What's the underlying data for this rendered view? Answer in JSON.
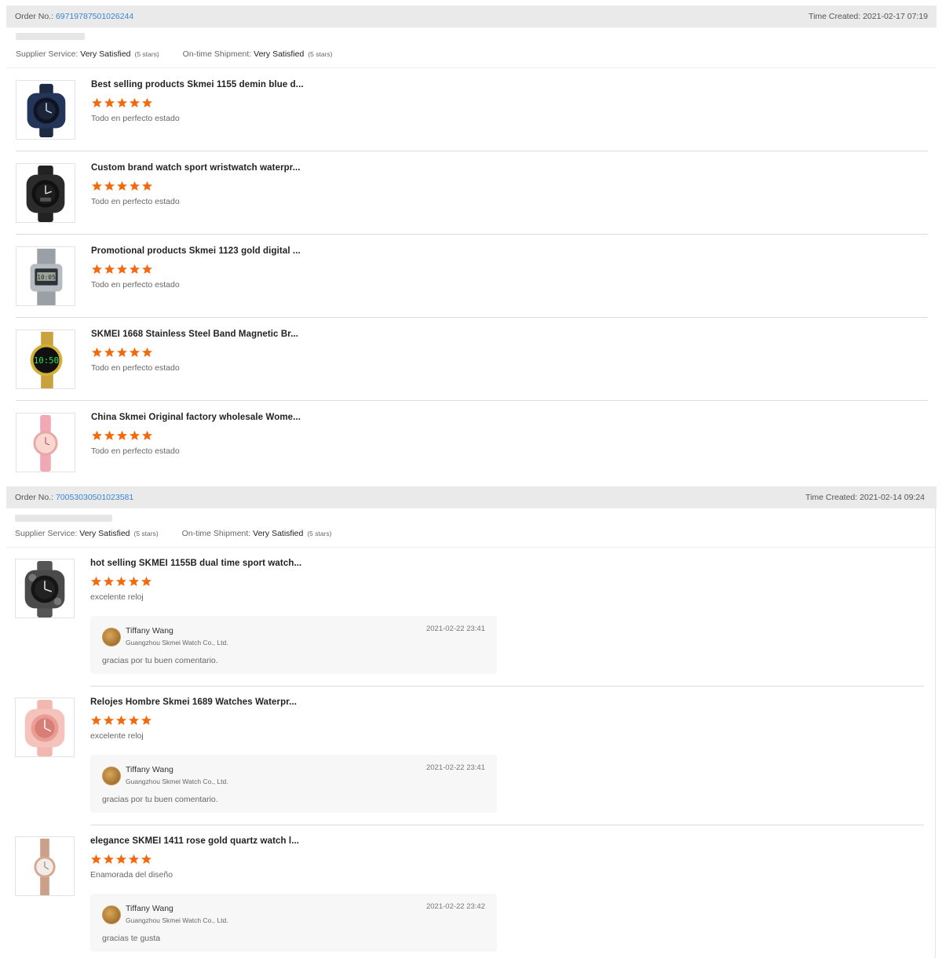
{
  "orders": [
    {
      "order_no_label": "Order No.:",
      "order_no": "69719787501026244",
      "time_created": "Time Created: 2021-02-17 07:19",
      "supplier_service_label": "Supplier Service:",
      "supplier_service_value": "Very Satisfied",
      "supplier_service_stars": "(5 stars)",
      "shipment_label": "On-time Shipment:",
      "shipment_value": "Very Satisfied",
      "shipment_stars": "(5 stars)",
      "items": [
        {
          "title": "Best selling products Skmei 1155 demin blue d...",
          "rating": 5,
          "comment": "Todo en perfecto estado",
          "thumb": "blue-sport-watch"
        },
        {
          "title": "Custom brand watch sport wristwatch waterpr...",
          "rating": 5,
          "comment": "Todo en perfecto estado",
          "thumb": "black-sport-watch"
        },
        {
          "title": "Promotional products Skmei 1123 gold digital ...",
          "rating": 5,
          "comment": "Todo en perfecto estado",
          "thumb": "silver-digital-watch"
        },
        {
          "title": "SKMEI 1668 Stainless Steel Band Magnetic Br...",
          "rating": 5,
          "comment": "Todo en perfecto estado",
          "thumb": "gold-led-watch"
        },
        {
          "title": "China Skmei Original factory wholesale Wome...",
          "rating": 5,
          "comment": "Todo en perfecto estado",
          "thumb": "pink-women-watch"
        }
      ]
    },
    {
      "order_no_label": "Order No.:",
      "order_no": "70053030501023581",
      "time_created": "Time Created: 2021-02-14 09:24",
      "supplier_service_label": "Supplier Service:",
      "supplier_service_value": "Very Satisfied",
      "supplier_service_stars": "(5 stars)",
      "shipment_label": "On-time Shipment:",
      "shipment_value": "Very Satisfied",
      "shipment_stars": "(5 stars)",
      "items": [
        {
          "title": "hot selling SKMEI 1155B dual time sport watch...",
          "rating": 5,
          "comment": "excelente reloj",
          "thumb": "camo-sport-watch",
          "reply": {
            "name": "Tiffany Wang",
            "company": "Guangzhou Skmei Watch Co., Ltd.",
            "time": "2021-02-22 23:41",
            "text": "gracias por tu buen comentario."
          }
        },
        {
          "title": "Relojes Hombre Skmei 1689 Watches Waterpr...",
          "rating": 5,
          "comment": "excelente reloj",
          "thumb": "pink-sport-watch",
          "reply": {
            "name": "Tiffany Wang",
            "company": "Guangzhou Skmei Watch Co., Ltd.",
            "time": "2021-02-22 23:41",
            "text": "gracias por tu buen comentario."
          }
        },
        {
          "title": "elegance SKMEI 1411 rose gold quartz watch l...",
          "rating": 5,
          "comment": "Enamorada del diseño",
          "thumb": "rose-gold-watch",
          "reply": {
            "name": "Tiffany Wang",
            "company": "Guangzhou Skmei Watch Co., Ltd.",
            "time": "2021-02-22 23:42",
            "text": "gracias te gusta"
          }
        }
      ]
    }
  ],
  "colors": {
    "star": "#f26a10",
    "link": "#3a86d4",
    "header_bg": "#eaeaea"
  }
}
